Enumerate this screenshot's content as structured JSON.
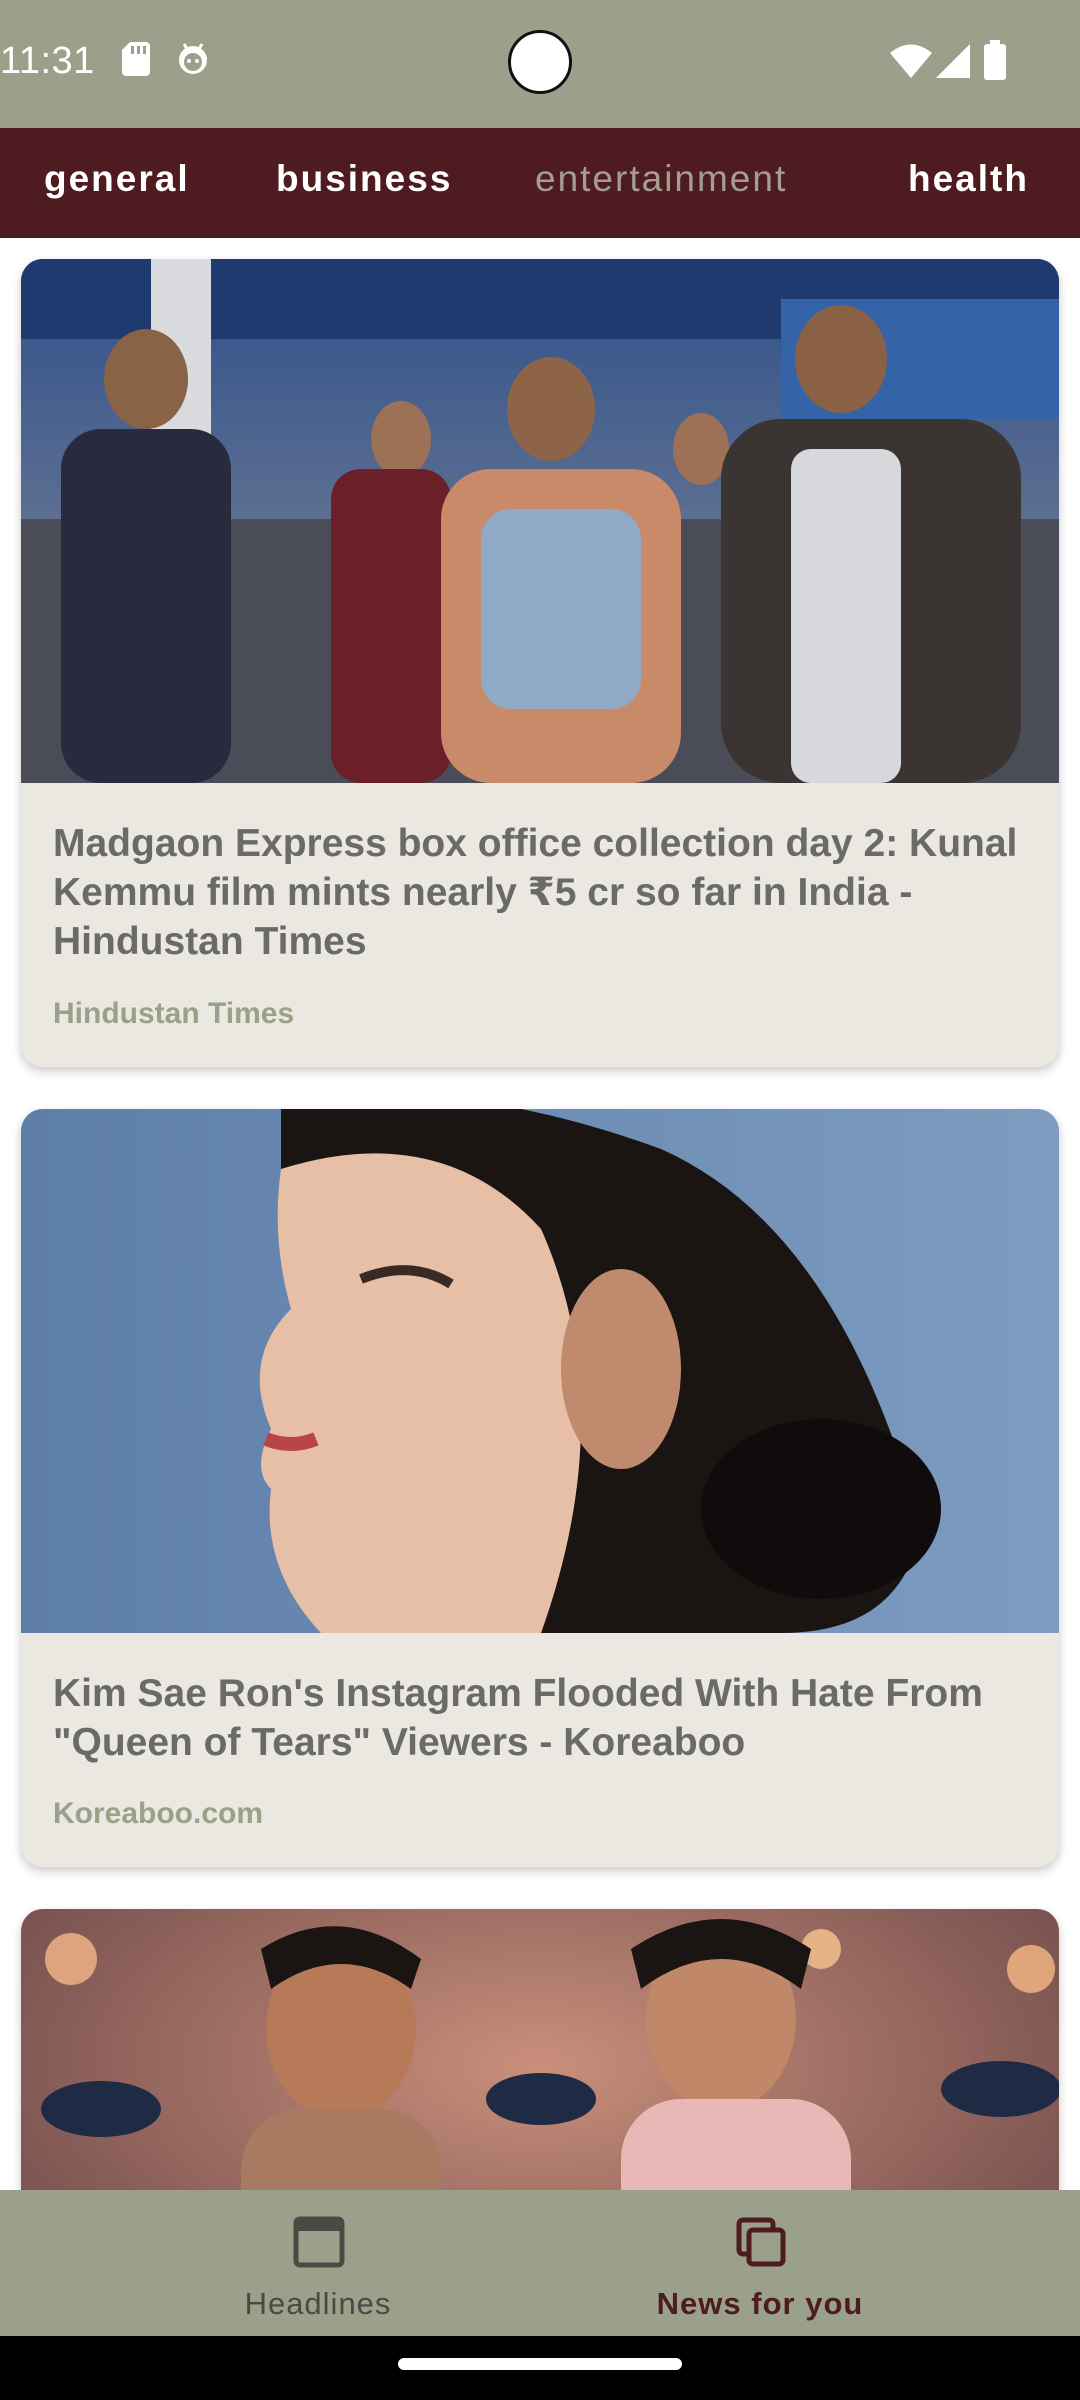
{
  "status_bar": {
    "time": "11:31",
    "left_icons": [
      "sd-card-icon",
      "android-head-icon"
    ],
    "right_icons": [
      "wifi-icon",
      "cellular-signal-icon",
      "battery-icon"
    ]
  },
  "categories": {
    "items": [
      {
        "label": "general"
      },
      {
        "label": "business"
      },
      {
        "label": "entertainment",
        "muted": true
      },
      {
        "label": "health"
      }
    ]
  },
  "articles": [
    {
      "title": "Madgaon Express box office collection day 2: Kunal Kemmu film mints nearly ₹5 cr so far in India - Hindustan Times",
      "source": "Hindustan Times",
      "image": "photo-group-of-men-walking-airport"
    },
    {
      "title": "Kim Sae Ron's Instagram Flooded With Hate From \"Queen of Tears\" Viewers - Koreaboo",
      "source": "Koreaboo.com",
      "image": "photo-woman-profile-portrait"
    },
    {
      "title": "",
      "source": "",
      "image": "photo-two-men-dancing-holi-colors"
    }
  ],
  "bottom_nav": {
    "items": [
      {
        "label": "Headlines",
        "icon": "headlines-icon",
        "active": false
      },
      {
        "label": "News for you",
        "icon": "news-for-you-icon",
        "active": true
      }
    ]
  },
  "colors": {
    "status_bar": "#9ba08a",
    "category_bar": "#4e1c20",
    "card_bg": "#eae8e1",
    "source_text": "#9ba08a",
    "title_text": "#6a6a66",
    "active_nav": "#4e1c20"
  }
}
